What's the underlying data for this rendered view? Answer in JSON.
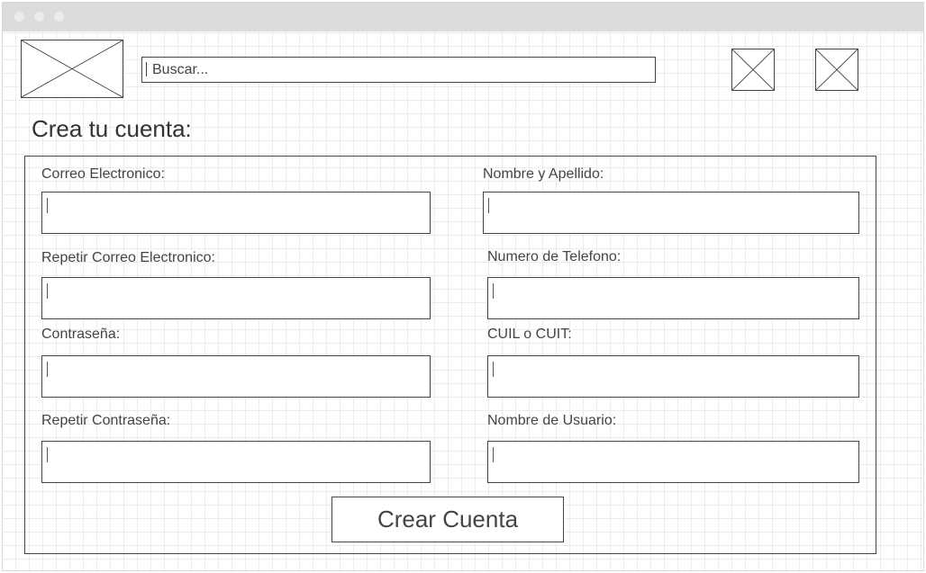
{
  "header": {
    "search": {
      "placeholder": "Buscar..."
    }
  },
  "page": {
    "title": "Crea tu cuenta:"
  },
  "form": {
    "fields": {
      "email": {
        "label": "Correo Electronico:",
        "value": ""
      },
      "repeat_email": {
        "label": "Repetir Correo Electronico:",
        "value": ""
      },
      "password": {
        "label": "Contraseña:",
        "value": ""
      },
      "repeat_password": {
        "label": "Repetir Contraseña:",
        "value": ""
      },
      "full_name": {
        "label": "Nombre y Apellido:",
        "value": ""
      },
      "phone": {
        "label": "Numero de Telefono:",
        "value": ""
      },
      "cuil_cuit": {
        "label": "CUIL o CUIT:",
        "value": ""
      },
      "username": {
        "label": "Nombre de Usuario:",
        "value": ""
      }
    },
    "submit_label": "Crear Cuenta"
  },
  "icons": [
    "logo-image-placeholder",
    "header-icon-1-placeholder",
    "header-icon-2-placeholder"
  ]
}
